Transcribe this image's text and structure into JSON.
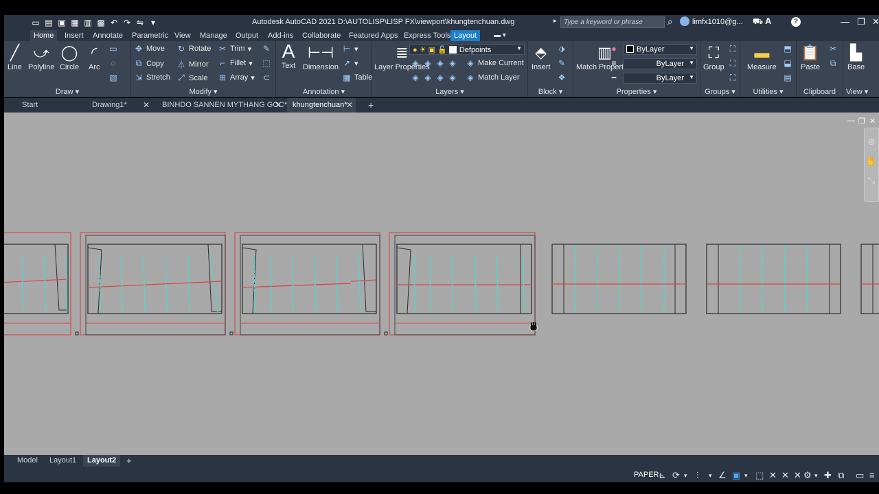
{
  "window": {
    "title": "Autodesk AutoCAD 2021    D:\\AUTOLISP\\LISP FX\\viewport\\khungtenchuan.dwg",
    "search_placeholder": "Type a keyword or phrase",
    "user_name": "limfx1010@g...",
    "qat_icons": [
      "new-icon",
      "open-icon",
      "save-icon",
      "saveas-icon",
      "publish-icon",
      "plot-icon",
      "undo-icon",
      "redo-icon",
      "share-icon",
      "qat-menu-icon"
    ]
  },
  "ribbon_tabs": [
    {
      "label": "Home",
      "state": "active"
    },
    {
      "label": "Insert"
    },
    {
      "label": "Annotate"
    },
    {
      "label": "Parametric"
    },
    {
      "label": "View"
    },
    {
      "label": "Manage"
    },
    {
      "label": "Output"
    },
    {
      "label": "Add-ins"
    },
    {
      "label": "Collaborate"
    },
    {
      "label": "Featured Apps"
    },
    {
      "label": "Express Tools"
    },
    {
      "label": "Layout",
      "state": "contextual"
    }
  ],
  "ribbon": {
    "draw": {
      "title": "Draw",
      "line": "Line",
      "polyline": "Polyline",
      "circle": "Circle",
      "arc": "Arc"
    },
    "modify": {
      "title": "Modify",
      "move": "Move",
      "rotate": "Rotate",
      "trim": "Trim",
      "copy": "Copy",
      "mirror": "Mirror",
      "fillet": "Fillet",
      "stretch": "Stretch",
      "scale": "Scale",
      "array": "Array"
    },
    "annotation": {
      "title": "Annotation",
      "text": "Text",
      "dimension": "Dimension",
      "table": "Table"
    },
    "layers": {
      "title": "Layers",
      "layer_properties": "Layer Properties",
      "current_layer": "Defpoints",
      "make_current": "Make Current",
      "match_layer": "Match Layer"
    },
    "block": {
      "title": "Block",
      "insert": "Insert"
    },
    "properties": {
      "title": "Properties",
      "match_properties": "Match Properties",
      "color": "ByLayer",
      "linetype": "ByLayer",
      "lineweight": "ByLayer"
    },
    "groups": {
      "title": "Groups",
      "group": "Group"
    },
    "utilities": {
      "title": "Utilities",
      "measure": "Measure"
    },
    "clipboard": {
      "title": "Clipboard",
      "paste": "Paste"
    },
    "view": {
      "title": "View",
      "base": "Base"
    }
  },
  "file_tabs": [
    {
      "label": "Start"
    },
    {
      "label": "Drawing1*"
    },
    {
      "label": "BINHDO SANNEN MYTHANG GOC*"
    },
    {
      "label": "khungtenchuan*",
      "state": "active"
    }
  ],
  "layout_tabs": [
    {
      "label": "Model"
    },
    {
      "label": "Layout1"
    },
    {
      "label": "Layout2",
      "state": "active"
    }
  ],
  "status": {
    "space": "PAPER"
  },
  "colors": {
    "frame_red": "#d24a4a",
    "line_cyan": "#3fe0d0",
    "line_black": "#2a2a2a",
    "ui_dark": "#2b3442",
    "ui_panel": "#3b4453",
    "accent_blue": "#1e7fc9",
    "canvas": "#a9a9a9"
  }
}
